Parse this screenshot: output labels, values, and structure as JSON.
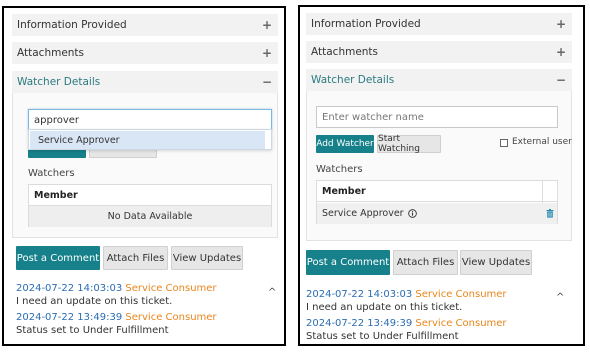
{
  "accordion": {
    "information_provided": "Information Provided",
    "attachments": "Attachments",
    "watcher_details": "Watcher Details",
    "collapsed_sign": "+",
    "expanded_sign": "−"
  },
  "left": {
    "search_value": "approver",
    "dropdown_option": "Service Approver",
    "watchers_label": "Watchers",
    "member_header": "Member",
    "no_data": "No Data Available"
  },
  "right": {
    "watcher_placeholder": "Enter watcher name",
    "add_watcher": "Add Watcher",
    "start_watching": "Start Watching",
    "external_user": "External user",
    "watchers_label": "Watchers",
    "member_header": "Member",
    "member_name": "Service Approver",
    "info_icon": "info-icon",
    "delete_icon": "trash-icon"
  },
  "actions": {
    "post_comment": "Post a Comment",
    "attach_files": "Attach Files",
    "view_updates": "View Updates"
  },
  "activity": [
    {
      "date": "2024-07-22 14:03:03",
      "user": "Service Consumer",
      "text": "I need an update on this ticket."
    },
    {
      "date": "2024-07-22 13:49:39",
      "user": "Service Consumer",
      "text": "Status set to Under Fulfillment"
    }
  ],
  "colors": {
    "primary": "#16818a",
    "active_header": "#2c7a80",
    "date": "#2b6db3",
    "user": "#e8861c"
  }
}
